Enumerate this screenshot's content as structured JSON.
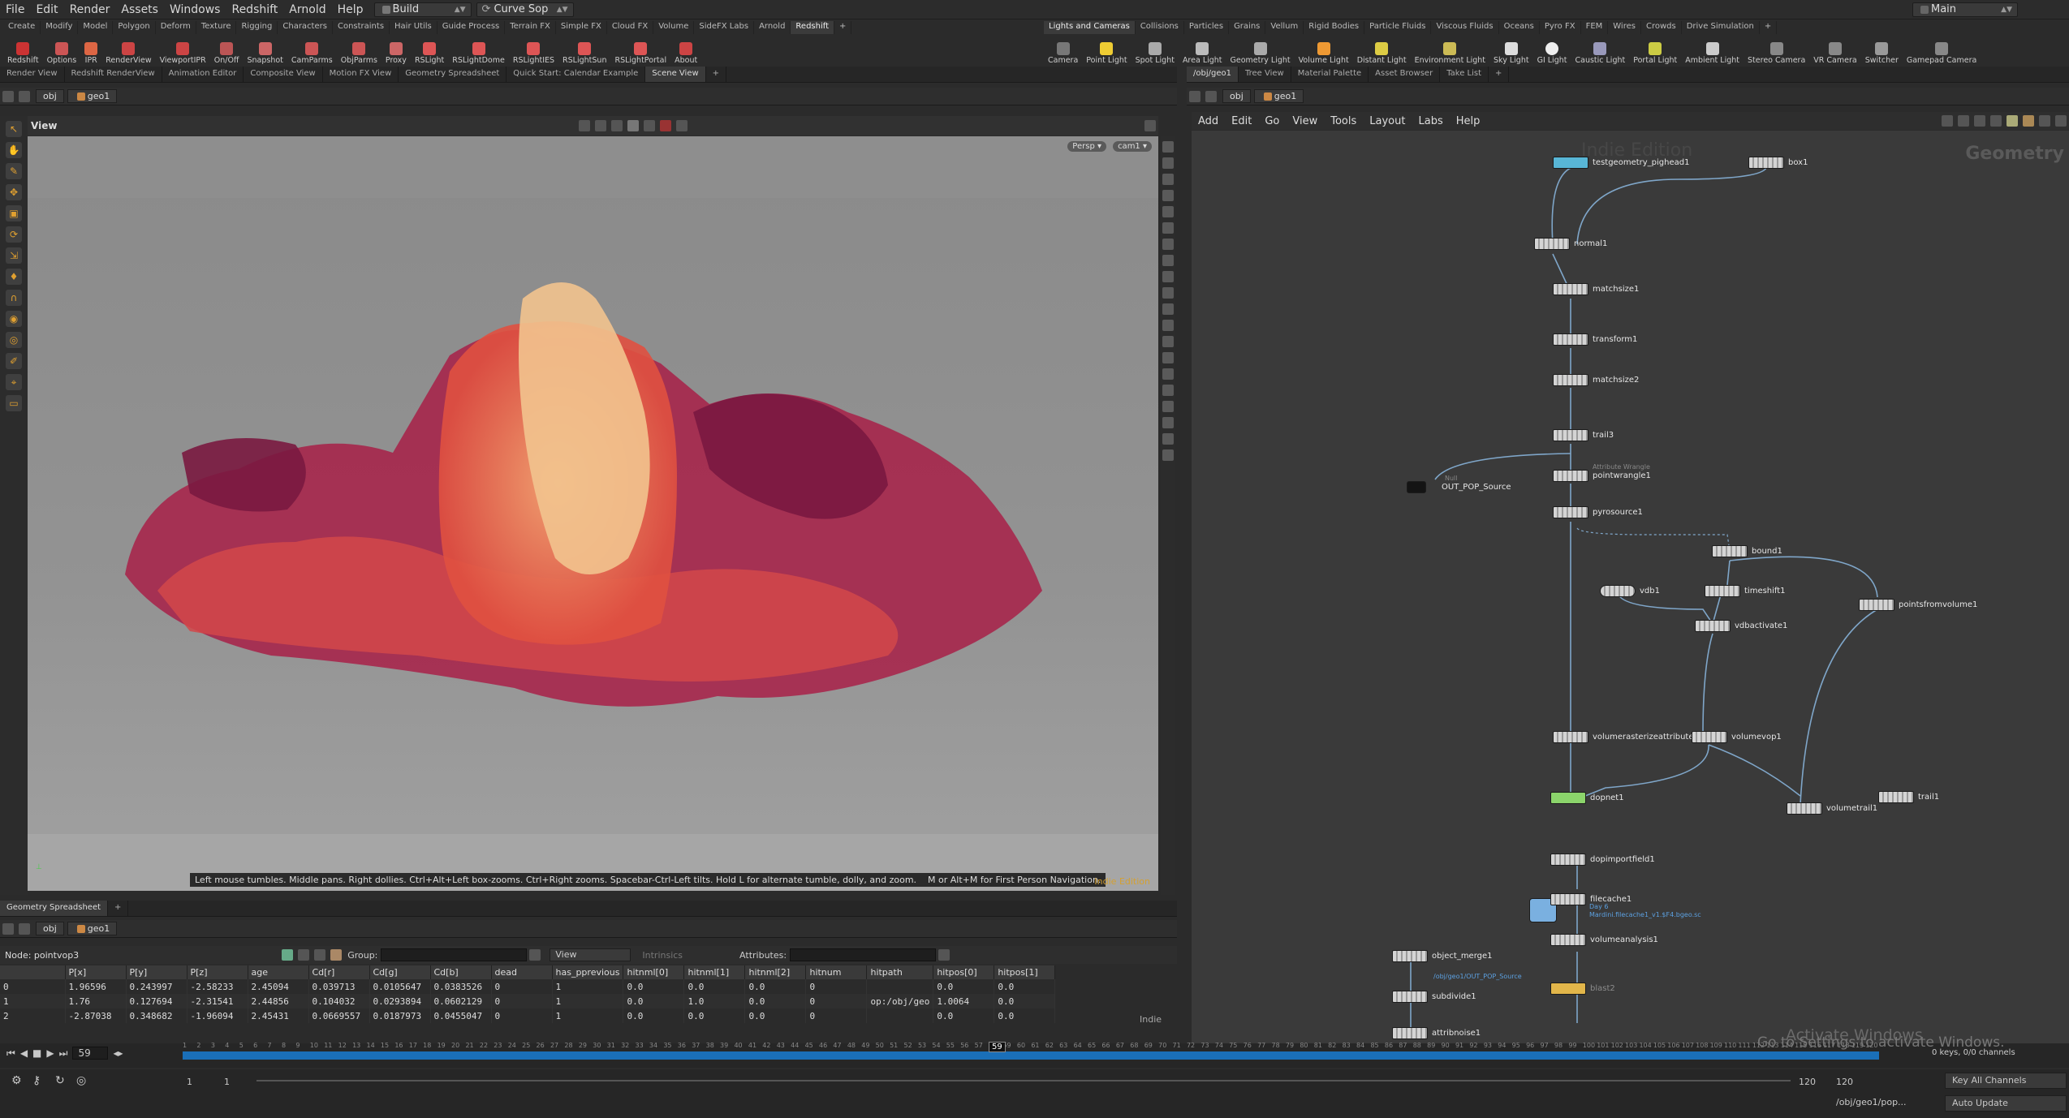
{
  "menubar": {
    "items": [
      "File",
      "Edit",
      "Render",
      "Assets",
      "Windows",
      "Redshift",
      "Arnold",
      "Help"
    ],
    "desktop": "Build",
    "context": "Curve Sop",
    "main": "Main"
  },
  "shelf_left": {
    "tabs": [
      "Create",
      "Modify",
      "Model",
      "Polygon",
      "Deform",
      "Texture",
      "Rigging",
      "Characters",
      "Constraints",
      "Hair Utils",
      "Guide Process",
      "Terrain FX",
      "Simple FX",
      "Cloud FX",
      "Volume",
      "SideFX Labs",
      "Arnold",
      "Redshift"
    ],
    "active_tab": "Redshift",
    "tools": [
      "Redshift",
      "Options",
      "IPR",
      "RenderView",
      "ViewportIPR",
      "On/Off",
      "Snapshot",
      "CamParms",
      "ObjParms",
      "Proxy",
      "RSLight",
      "RSLightDome",
      "RSLightIES",
      "RSLightSun",
      "RSLightPortal",
      "About"
    ]
  },
  "shelf_right": {
    "tabs": [
      "Lights and Cameras",
      "Collisions",
      "Particles",
      "Grains",
      "Vellum",
      "Rigid Bodies",
      "Particle Fluids",
      "Viscous Fluids",
      "Oceans",
      "Pyro FX",
      "FEM",
      "Wires",
      "Crowds",
      "Drive Simulation"
    ],
    "active_tab": "Lights and Cameras",
    "tools": [
      "Camera",
      "Point Light",
      "Spot Light",
      "Area Light",
      "Geometry Light",
      "Volume Light",
      "Distant Light",
      "Environment Light",
      "Sky Light",
      "GI Light",
      "Caustic Light",
      "Portal Light",
      "Ambient Light",
      "Stereo Camera",
      "VR Camera",
      "Switcher",
      "Gamepad Camera"
    ]
  },
  "left_tabs": [
    "Render View",
    "Redshift RenderView",
    "Animation Editor",
    "Composite View",
    "Motion FX View",
    "Geometry Spreadsheet",
    "Quick Start: Calendar Example",
    "Scene View"
  ],
  "left_active_tab": "Scene View",
  "right_tabs": [
    "/obj/geo1",
    "Tree View",
    "Material Palette",
    "Asset Browser",
    "Take List"
  ],
  "right_active_tab": "/obj/geo1",
  "path": {
    "obj": "obj",
    "geo": "geo1"
  },
  "viewport": {
    "title": "View",
    "persp": "Persp",
    "cam": "cam1",
    "hint": "Left mouse tumbles. Middle pans. Right dollies. Ctrl+Alt+Left box-zooms. Ctrl+Right zooms. Spacebar-Ctrl-Left tilts. Hold L for alternate tumble, dolly, and zoom.    M or Alt+M for First Person Navigation.",
    "edition": "Indie Edition"
  },
  "network": {
    "menu": [
      "Add",
      "Edit",
      "Go",
      "View",
      "Tools",
      "Layout",
      "Labs",
      "Help"
    ],
    "watermark": "Indie Edition",
    "context_label": "Geometry",
    "nodes": [
      {
        "name": "testgeometry_pighead1",
        "color": "blue"
      },
      {
        "name": "box1",
        "color": "gray"
      },
      {
        "name": "normal1",
        "color": "gray"
      },
      {
        "name": "matchsize1",
        "color": "gray"
      },
      {
        "name": "transform1",
        "color": "gray"
      },
      {
        "name": "matchsize2",
        "color": "gray"
      },
      {
        "name": "trail3",
        "color": "gray"
      },
      {
        "name": "pointwrangle1",
        "color": "gray",
        "comment": "Attribute Wrangle"
      },
      {
        "name": "OUT_POP_Source",
        "color": "dark",
        "comment": "Null"
      },
      {
        "name": "pyrosource1",
        "color": "gray"
      },
      {
        "name": "bound1",
        "color": "gray"
      },
      {
        "name": "vdb1",
        "color": "gray"
      },
      {
        "name": "timeshift1",
        "color": "gray"
      },
      {
        "name": "pointsfromvolume1",
        "color": "gray"
      },
      {
        "name": "vdbactivate1",
        "color": "gray"
      },
      {
        "name": "volumerasterizeattributes1",
        "color": "gray"
      },
      {
        "name": "volumevop1",
        "color": "gray"
      },
      {
        "name": "dopnet1",
        "color": "green"
      },
      {
        "name": "volumetrail1",
        "color": "gray"
      },
      {
        "name": "trail1",
        "color": "gray"
      },
      {
        "name": "dopimportfield1",
        "color": "gray"
      },
      {
        "name": "filecache1",
        "color": "gray",
        "comment": "Day 6",
        "path": "Mardini.filecache1_v1.$F4.bgeo.sc"
      },
      {
        "name": "volumeanalysis1",
        "color": "gray"
      },
      {
        "name": "object_merge1",
        "color": "gray",
        "path": "/obj/geo1/OUT_POP_Source"
      },
      {
        "name": "blast2",
        "color": "yellow"
      },
      {
        "name": "subdivide1",
        "color": "gray"
      },
      {
        "name": "attribnoise1",
        "color": "gray"
      }
    ],
    "activate": {
      "title": "Activate Windows",
      "sub": "Go to Settings to activate Windows."
    }
  },
  "spreadsheet": {
    "tab": "Geometry Spreadsheet",
    "node_label": "Node: pointvop3",
    "group_label": "Group:",
    "view_label": "View",
    "intrinsics_label": "Intrinsics",
    "attributes_label": "Attributes:",
    "columns": [
      "",
      "P[x]",
      "P[y]",
      "P[z]",
      "age",
      "Cd[r]",
      "Cd[g]",
      "Cd[b]",
      "dead",
      "has_pprevious",
      "hitnml[0]",
      "hitnml[1]",
      "hitnml[2]",
      "hitnum",
      "hitpath",
      "hitpos[0]",
      "hitpos[1]"
    ],
    "rows": [
      [
        "0",
        "1.96596",
        "0.243997",
        "-2.58233",
        "2.45094",
        "0.039713",
        "0.0105647",
        "0.0383526",
        "0",
        "1",
        "0.0",
        "0.0",
        "0.0",
        "0",
        "",
        "0.0",
        "0.0"
      ],
      [
        "1",
        "1.76",
        "0.127694",
        "-2.31541",
        "2.44856",
        "0.104032",
        "0.0293894",
        "0.0602129",
        "0",
        "1",
        "0.0",
        "1.0",
        "0.0",
        "0",
        "op:/obj/geo",
        "1.0064",
        "0.0"
      ],
      [
        "2",
        "-2.87038",
        "0.348682",
        "-1.96094",
        "2.45431",
        "0.0669557",
        "0.0187973",
        "0.0455047",
        "0",
        "1",
        "0.0",
        "0.0",
        "0.0",
        "0",
        "",
        "0.0",
        "0.0"
      ]
    ],
    "indie": "Indie"
  },
  "timeline": {
    "frame": "59",
    "current_marker": "59",
    "start": "1",
    "start2": "1",
    "end": "120",
    "end2": "120",
    "keys": "0 keys, 0/0 channels",
    "key_all": "Key All Channels",
    "auto_update": "Auto Update",
    "status_path": "/obj/geo1/pop...",
    "ticks": [
      "1",
      "2",
      "3",
      "4",
      "5",
      "6",
      "7",
      "8",
      "9",
      "10",
      "11",
      "12",
      "13",
      "14",
      "15",
      "16",
      "17",
      "18",
      "19",
      "20",
      "21",
      "22",
      "23",
      "24",
      "25",
      "26",
      "27",
      "28",
      "29",
      "30",
      "31",
      "32",
      "33",
      "34",
      "35",
      "36",
      "37",
      "38",
      "39",
      "40",
      "41",
      "42",
      "43",
      "44",
      "45",
      "46",
      "47",
      "48",
      "49",
      "50",
      "51",
      "52",
      "53",
      "54",
      "55",
      "56",
      "57",
      "58",
      "59",
      "60",
      "61",
      "62",
      "63",
      "64",
      "65",
      "66",
      "67",
      "68",
      "69",
      "70",
      "71",
      "72",
      "73",
      "74",
      "75",
      "76",
      "77",
      "78",
      "79",
      "80",
      "81",
      "82",
      "83",
      "84",
      "85",
      "86",
      "87",
      "88",
      "89",
      "90",
      "91",
      "92",
      "93",
      "94",
      "95",
      "96",
      "97",
      "98",
      "99",
      "100",
      "101",
      "102",
      "103",
      "104",
      "105",
      "106",
      "107",
      "108",
      "109",
      "110",
      "111",
      "112",
      "113",
      "114",
      "115",
      "116",
      "117",
      "118",
      "119",
      "120"
    ]
  },
  "colors": {
    "accent": "#1a6fb8",
    "node_blue": "#58b6d6",
    "node_green": "#8bd46b",
    "node_yellow": "#e2b64a"
  }
}
